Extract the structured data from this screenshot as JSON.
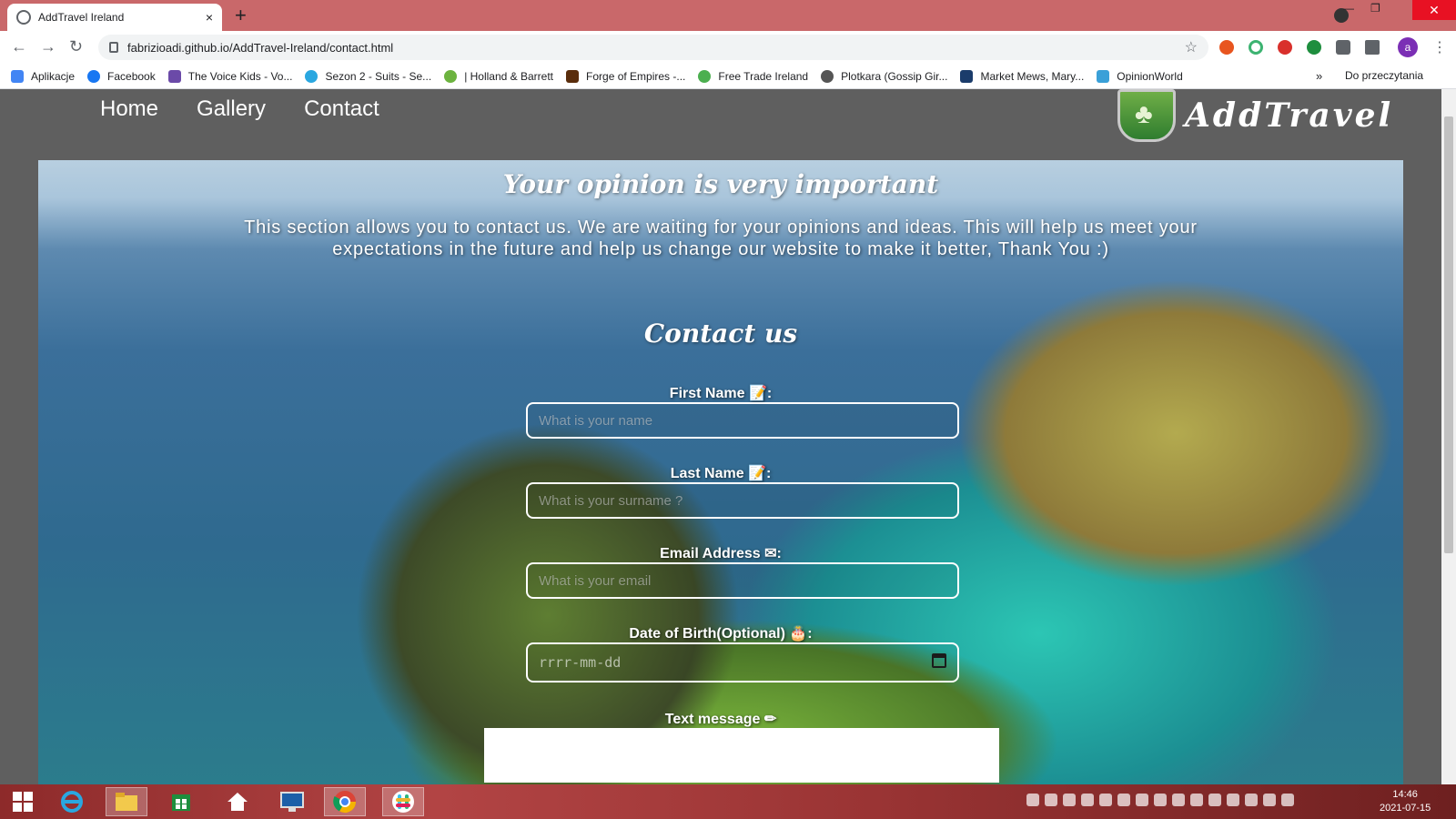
{
  "browser": {
    "tab_title": "AddTravel Ireland",
    "tab_close": "×",
    "new_tab": "+",
    "url": "fabrizioadi.github.io/AddTravel-Ireland/contact.html",
    "profile_initial": "a",
    "nav": {
      "back": "←",
      "forward": "→",
      "reload": "↻"
    },
    "star": "☆",
    "menu": "⋮"
  },
  "bookmarks": {
    "items": [
      {
        "label": "Aplikacje",
        "color": "#4285f4"
      },
      {
        "label": "Facebook",
        "color": "#1877f2"
      },
      {
        "label": "The Voice Kids - Vo...",
        "color": "#6b4aa8"
      },
      {
        "label": "Sezon 2 - Suits - Se...",
        "color": "#2aa7e0"
      },
      {
        "label": "| Holland & Barrett",
        "color": "#6cb33f"
      },
      {
        "label": "Forge of Empires -...",
        "color": "#5a2d0c"
      },
      {
        "label": "Free Trade Ireland",
        "color": "#4caf50"
      },
      {
        "label": "Plotkara (Gossip Gir...",
        "color": "#555555"
      },
      {
        "label": "Market Mews, Mary...",
        "color": "#1b3c6b"
      },
      {
        "label": "OpinionWorld",
        "color": "#3aa0d8"
      }
    ],
    "more": "»",
    "reading_list": "Do przeczytania"
  },
  "page": {
    "nav": [
      {
        "label": "Home"
      },
      {
        "label": "Gallery"
      },
      {
        "label": "Contact"
      }
    ],
    "brand": "AddTravel",
    "hero_title": "Your opinion is very important",
    "hero_text": "This section allows you to contact us. We are waiting for your opinions and ideas. This will help us meet your expectations in the future and help us change our website to make it better, Thank You :)",
    "contact_title": "Contact us",
    "form": {
      "first_name_label": "First Name 📝:",
      "first_name_placeholder": "What is your name",
      "last_name_label": "Last Name 📝:",
      "last_name_placeholder": "What is your surname ?",
      "email_label": "Email Address ✉:",
      "email_placeholder": "What is your email",
      "dob_label": "Date of Birth(Optional) 🎂:",
      "dob_placeholder": "rrrr-mm-dd",
      "message_label": "Text message ✏"
    }
  },
  "taskbar": {
    "time": "14:46",
    "date": "2021-07-15"
  }
}
